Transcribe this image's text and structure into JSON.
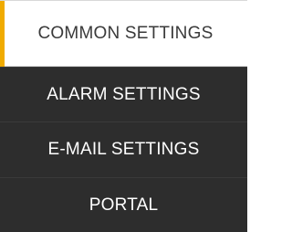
{
  "menu": {
    "items": [
      {
        "label": "COMMON SETTINGS",
        "active": true
      },
      {
        "label": "ALARM SETTINGS",
        "active": false
      },
      {
        "label": "E-MAIL SETTINGS",
        "active": false
      },
      {
        "label": "PORTAL",
        "active": false
      }
    ]
  },
  "colors": {
    "accent": "#f0ab00",
    "inactive_background": "#2d2d2d",
    "active_background": "#ffffff",
    "inactive_text": "#ffffff",
    "active_text": "#3a3a3a"
  }
}
